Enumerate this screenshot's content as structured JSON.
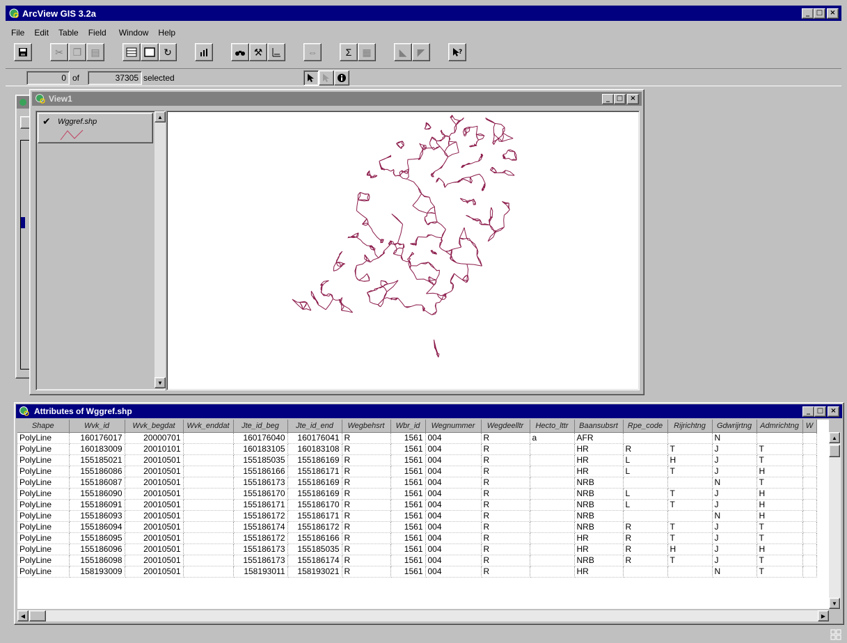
{
  "app": {
    "title": "ArcView GIS 3.2a",
    "window_controls": [
      "_",
      "□",
      "×"
    ]
  },
  "menu": [
    "File",
    "Edit",
    "Table",
    "Field",
    "Window",
    "Help"
  ],
  "selection": {
    "count": "0",
    "of_label": "of",
    "total": "37305",
    "selected_label": "selected"
  },
  "view1": {
    "title": "View1",
    "layer_name": "Wggref.shp",
    "layer_visible": true,
    "line_color": "#8b1a4a"
  },
  "attributes": {
    "title": "Attributes of Wggref.shp",
    "columns": [
      "Shape",
      "Wvk_id",
      "Wvk_begdat",
      "Wvk_enddat",
      "Jte_id_beg",
      "Jte_id_end",
      "Wegbehsrt",
      "Wbr_id",
      "Wegnummer",
      "Wegdeelltr",
      "Hecto_lttr",
      "Baansubsrt",
      "Rpe_code",
      "Rijrichtng",
      "Gdwrijrtng",
      "Admrichtng",
      "W"
    ],
    "rows": [
      [
        "PolyLine",
        "160176017",
        "20000701",
        "",
        "160176040",
        "160176041",
        "R",
        "1561",
        "004",
        "R",
        "a",
        "AFR",
        "",
        "",
        "N",
        "",
        ""
      ],
      [
        "PolyLine",
        "160183009",
        "20010101",
        "",
        "160183105",
        "160183108",
        "R",
        "1561",
        "004",
        "R",
        "",
        "HR",
        "R",
        "T",
        "J",
        "T",
        ""
      ],
      [
        "PolyLine",
        "155185021",
        "20010501",
        "",
        "155185035",
        "155186169",
        "R",
        "1561",
        "004",
        "R",
        "",
        "HR",
        "L",
        "H",
        "J",
        "T",
        ""
      ],
      [
        "PolyLine",
        "155186086",
        "20010501",
        "",
        "155186166",
        "155186171",
        "R",
        "1561",
        "004",
        "R",
        "",
        "HR",
        "L",
        "T",
        "J",
        "H",
        ""
      ],
      [
        "PolyLine",
        "155186087",
        "20010501",
        "",
        "155186173",
        "155186169",
        "R",
        "1561",
        "004",
        "R",
        "",
        "NRB",
        "",
        "",
        "N",
        "T",
        ""
      ],
      [
        "PolyLine",
        "155186090",
        "20010501",
        "",
        "155186170",
        "155186169",
        "R",
        "1561",
        "004",
        "R",
        "",
        "NRB",
        "L",
        "T",
        "J",
        "H",
        ""
      ],
      [
        "PolyLine",
        "155186091",
        "20010501",
        "",
        "155186171",
        "155186170",
        "R",
        "1561",
        "004",
        "R",
        "",
        "NRB",
        "L",
        "T",
        "J",
        "H",
        ""
      ],
      [
        "PolyLine",
        "155186093",
        "20010501",
        "",
        "155186172",
        "155186171",
        "R",
        "1561",
        "004",
        "R",
        "",
        "NRB",
        "",
        "",
        "N",
        "H",
        ""
      ],
      [
        "PolyLine",
        "155186094",
        "20010501",
        "",
        "155186174",
        "155186172",
        "R",
        "1561",
        "004",
        "R",
        "",
        "NRB",
        "R",
        "T",
        "J",
        "T",
        ""
      ],
      [
        "PolyLine",
        "155186095",
        "20010501",
        "",
        "155186172",
        "155186166",
        "R",
        "1561",
        "004",
        "R",
        "",
        "HR",
        "R",
        "T",
        "J",
        "T",
        ""
      ],
      [
        "PolyLine",
        "155186096",
        "20010501",
        "",
        "155186173",
        "155185035",
        "R",
        "1561",
        "004",
        "R",
        "",
        "HR",
        "R",
        "H",
        "J",
        "H",
        ""
      ],
      [
        "PolyLine",
        "155186098",
        "20010501",
        "",
        "155186173",
        "155186174",
        "R",
        "1561",
        "004",
        "R",
        "",
        "NRB",
        "R",
        "T",
        "J",
        "T",
        ""
      ],
      [
        "PolyLine",
        "158193009",
        "20010501",
        "",
        "158193011",
        "158193021",
        "R",
        "1561",
        "004",
        "R",
        "",
        "HR",
        "",
        "",
        "N",
        "T",
        ""
      ]
    ]
  }
}
